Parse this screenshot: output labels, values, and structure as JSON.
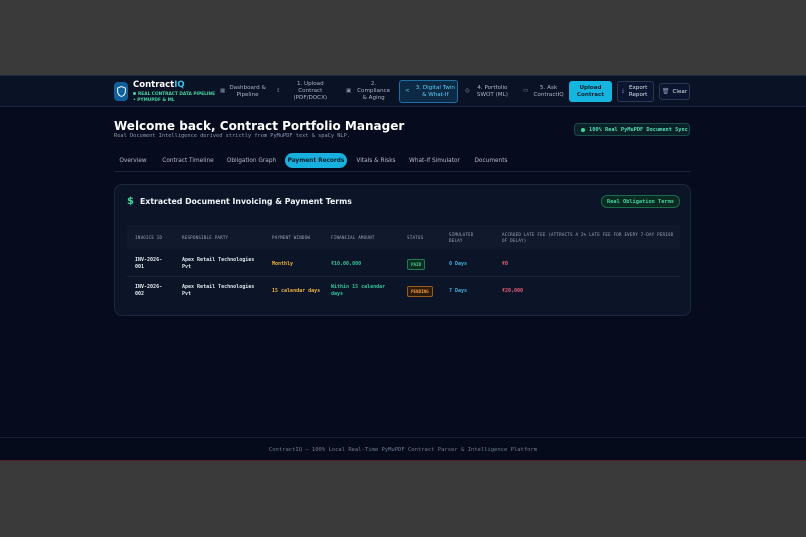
{
  "brand": {
    "name_prefix": "Contract",
    "name_suffix": "IQ",
    "subtitle": "REAL CONTRACT DATA PIPELINE • PYMUPDF & ML"
  },
  "nav": [
    {
      "label": "Dashboard & Pipeline",
      "icon": "grid-icon",
      "active": false
    },
    {
      "label": "1. Upload Contract (PDF/DOCX)",
      "icon": "upload-icon",
      "active": false
    },
    {
      "label": "2. Compliance & Aging",
      "icon": "shield-icon",
      "active": false
    },
    {
      "label": "3. Digital Twin & What-If",
      "icon": "share-icon",
      "active": true
    },
    {
      "label": "4. Portfolio SWOT (ML)",
      "icon": "target-icon",
      "active": false
    },
    {
      "label": "5. Ask ContractIQ",
      "icon": "chat-icon",
      "active": false
    }
  ],
  "buttons": {
    "upload": "Upload Contract",
    "export": "Export Report",
    "clear": "Clear"
  },
  "header": {
    "title": "Welcome back, Contract Portfolio Manager",
    "subtitle": "Real Document Intelligence derived strictly from PyMuPDF text & spaCy NLP.",
    "sync_badge": "100% Real PyMuPDF Document Sync"
  },
  "tabs": [
    {
      "label": "Overview",
      "active": false
    },
    {
      "label": "Contract Timeline",
      "active": false
    },
    {
      "label": "Obligation Graph",
      "active": false
    },
    {
      "label": "Payment Records",
      "active": true
    },
    {
      "label": "Vitals & Risks",
      "active": false
    },
    {
      "label": "What-If Simulator",
      "active": false
    },
    {
      "label": "Documents",
      "active": false
    }
  ],
  "card": {
    "title": "Extracted Document Invoicing & Payment Terms",
    "badge": "Real Obligation Terms",
    "columns": [
      "INVOICE ID",
      "RESPONSIBLE PARTY",
      "PAYMENT WINDOW",
      "FINANCIAL AMOUNT",
      "STATUS",
      "SIMULATED DELAY",
      "ACCRUED LATE FEE (ATTRACTS A 2% LATE FEE FOR EVERY 7-DAY PERIOD OF DELAY)"
    ],
    "rows": [
      {
        "id": "INV-2026-001",
        "party": "Apex Retail Technologies Pvt",
        "window": "Monthly",
        "amount": "₹10,00,000",
        "status": "PAID",
        "delay": "0 Days",
        "fee": "₹0"
      },
      {
        "id": "INV-2026-002",
        "party": "Apex Retail Technologies Pvt",
        "window": "15 calendar days",
        "amount": "Within 15 calendar days",
        "status": "PENDING",
        "delay": "7 Days",
        "fee": "₹20,000"
      }
    ]
  },
  "footer": "ContractIQ — 100% Local Real-Time PyMuPDF Contract Parser & Intelligence Platform",
  "colors": {
    "accent": "#18b1df",
    "success": "#3fd79e",
    "warning": "#f1b33b",
    "danger": "#ee5d78"
  }
}
